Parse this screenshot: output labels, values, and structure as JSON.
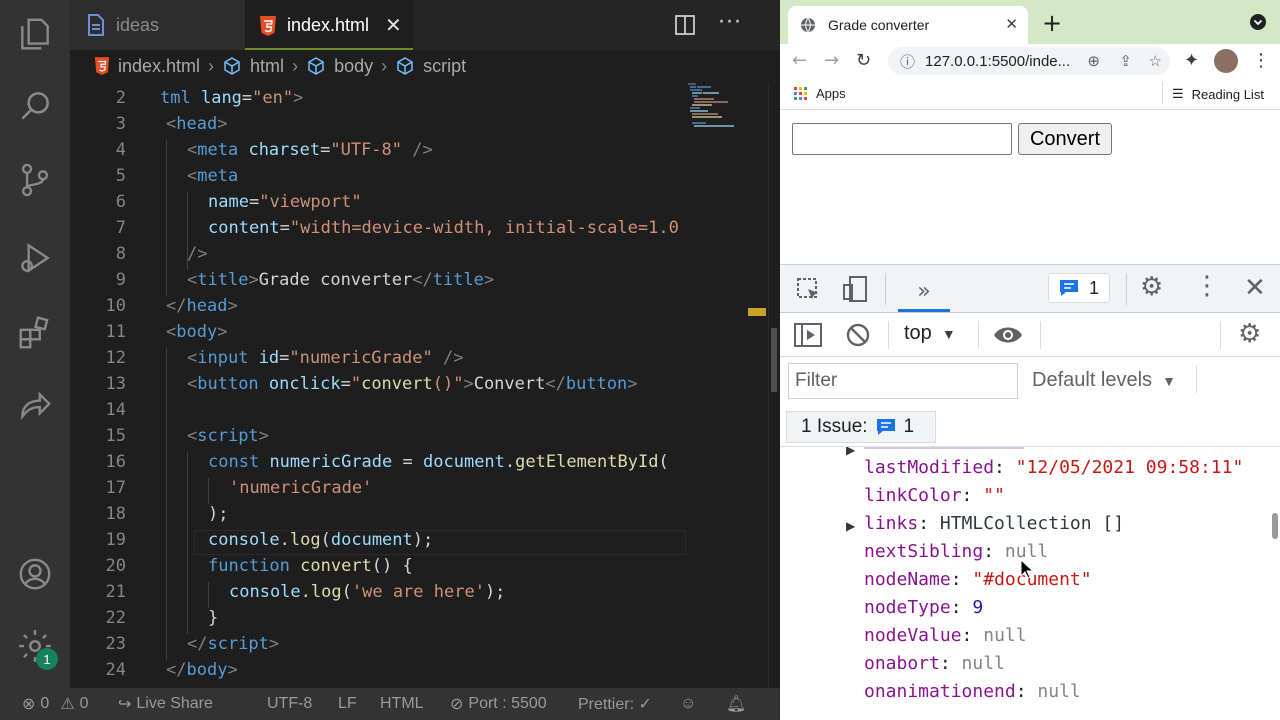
{
  "vscode": {
    "tabs": [
      {
        "label": "ideas",
        "icon": "file-icon",
        "active": false
      },
      {
        "label": "index.html",
        "icon": "html5-icon",
        "active": true
      }
    ],
    "breadcrumb": [
      "index.html",
      "html",
      "body",
      "script"
    ],
    "line_numbers": [
      "2",
      "3",
      "4",
      "5",
      "6",
      "7",
      "8",
      "9",
      "10",
      "11",
      "12",
      "13",
      "14",
      "15",
      "16",
      "17",
      "18",
      "19",
      "20",
      "21",
      "22",
      "23",
      "24"
    ],
    "settings_badge": "1",
    "status": {
      "errors": "0",
      "warnings": "0",
      "live_share": "Live Share",
      "encoding": "UTF-8",
      "eol": "LF",
      "language": "HTML",
      "port": "Port : 5500",
      "prettier": "Prettier: ✓"
    }
  },
  "code": {
    "l2": {
      "a": "tml",
      "b": "lang",
      "c": "\"en\""
    },
    "l3": {
      "t": "head"
    },
    "l4": {
      "t": "meta",
      "a": "charset",
      "v": "\"UTF-8\""
    },
    "l5": {
      "t": "meta"
    },
    "l6": {
      "a": "name",
      "v": "\"viewport\""
    },
    "l7": {
      "a": "content",
      "v": "\"width=device-width, initial-scale=1.0"
    },
    "l9": {
      "t": "title",
      "text": "Grade converter"
    },
    "l10": {
      "t": "head"
    },
    "l11": {
      "t": "body"
    },
    "l12": {
      "t": "input",
      "a": "id",
      "v": "\"numericGrade\""
    },
    "l13": {
      "t": "button",
      "a": "onclick",
      "v1": "\"",
      "fn": "convert",
      "v2": "()\"",
      "text": "Convert"
    },
    "l15": {
      "t": "script"
    },
    "l16": {
      "kw": "const",
      "id": "numericGrade",
      "obj": "document",
      "fn": "getElementById"
    },
    "l17": {
      "s": "'numericGrade'"
    },
    "l18": {
      "p": ");"
    },
    "l19": {
      "obj": "console",
      "fn": "log",
      "arg": "document"
    },
    "l20": {
      "kw": "function",
      "fn": "convert"
    },
    "l21": {
      "obj": "console",
      "fn": "log",
      "s": "'we are here'"
    },
    "l22": {
      "p": "}"
    },
    "l23": {
      "t": "script"
    },
    "l24": {
      "t": "body"
    }
  },
  "browser": {
    "tab_title": "Grade converter",
    "url": "127.0.0.1:5500/inde...",
    "bookmarks": {
      "apps": "Apps",
      "reading_list": "Reading List"
    },
    "page": {
      "button_label": "Convert",
      "input_value": ""
    }
  },
  "devtools": {
    "issues_count": "1",
    "context": "top",
    "filter_placeholder": "Filter",
    "levels": "Default levels",
    "issues_label": "1 Issue:",
    "issues_badge": "1",
    "properties": [
      {
        "key": "lastModified",
        "value": "\"12/05/2021 09:58:11\"",
        "kind": "string"
      },
      {
        "key": "linkColor",
        "value": "\"\"",
        "kind": "string"
      },
      {
        "key": "links",
        "value": "HTMLCollection []",
        "kind": "object"
      },
      {
        "key": "nextSibling",
        "value": "null",
        "kind": "null"
      },
      {
        "key": "nodeName",
        "value": "\"#document\"",
        "kind": "string"
      },
      {
        "key": "nodeType",
        "value": "9",
        "kind": "number"
      },
      {
        "key": "nodeValue",
        "value": "null",
        "kind": "null"
      },
      {
        "key": "onabort",
        "value": "null",
        "kind": "null"
      },
      {
        "key": "onanimationend",
        "value": "null",
        "kind": "null"
      }
    ]
  },
  "colors": {
    "vscode_bg": "#1e1e1e",
    "activity_bar": "#333333",
    "chrome_frame": "#d4e8c6",
    "devtools_blue": "#1a73e8"
  }
}
